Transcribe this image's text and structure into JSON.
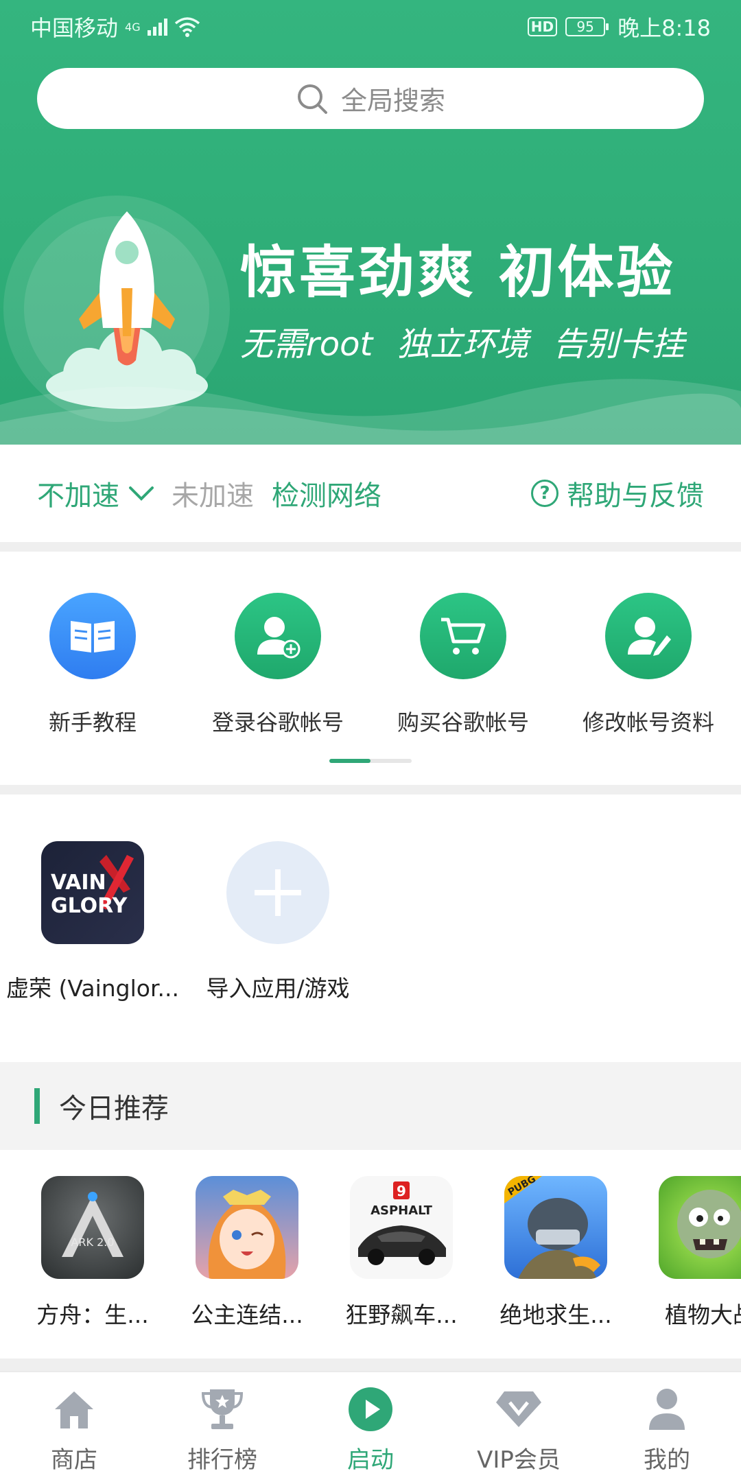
{
  "status_bar": {
    "carrier": "中国移动",
    "network": "4G",
    "hd_badge": "HD",
    "battery": "95",
    "time": "晚上8:18"
  },
  "search": {
    "placeholder": "全局搜索"
  },
  "banner": {
    "title": "惊喜劲爽  初体验",
    "subtitle": "无需root  独立环境  告别卡挂"
  },
  "speed": {
    "mode": "不加速",
    "status": "未加速",
    "check": "检测网络",
    "help": "帮助与反馈"
  },
  "actions": [
    {
      "label": "新手教程",
      "icon": "book-icon",
      "color": "#3d8ff5"
    },
    {
      "label": "登录谷歌帐号",
      "icon": "user-add-icon",
      "color": "#26b579"
    },
    {
      "label": "购买谷歌帐号",
      "icon": "cart-icon",
      "color": "#26b579"
    },
    {
      "label": "修改帐号资料",
      "icon": "user-edit-icon",
      "color": "#26b579"
    }
  ],
  "apps": [
    {
      "label": "虚荣 (Vainglor...",
      "icon_text_1": "VAIN",
      "icon_text_2": "GLORY"
    },
    {
      "label": "导入应用/游戏",
      "icon": "plus-icon"
    }
  ],
  "recommend": {
    "title": "今日推荐",
    "items": [
      {
        "label": "方舟：生...",
        "icon": "ark-game-icon",
        "icon_text": "ARK 2.0"
      },
      {
        "label": "公主连结...",
        "icon": "princess-connect-icon"
      },
      {
        "label": "狂野飙车...",
        "icon": "asphalt-icon",
        "icon_text": "ASPHALT",
        "badge": "9"
      },
      {
        "label": "绝地求生...",
        "icon": "pubg-icon",
        "icon_text": "PUBG"
      },
      {
        "label": "植物大战",
        "icon": "pvz-icon"
      }
    ]
  },
  "nav": [
    {
      "label": "商店",
      "icon": "home-icon"
    },
    {
      "label": "排行榜",
      "icon": "trophy-icon"
    },
    {
      "label": "启动",
      "icon": "play-icon"
    },
    {
      "label": "VIP会员",
      "icon": "diamond-icon"
    },
    {
      "label": "我的",
      "icon": "person-icon"
    }
  ],
  "colors": {
    "primary": "#2fa777",
    "header": "#34b57f",
    "blue": "#3d8ff5"
  }
}
